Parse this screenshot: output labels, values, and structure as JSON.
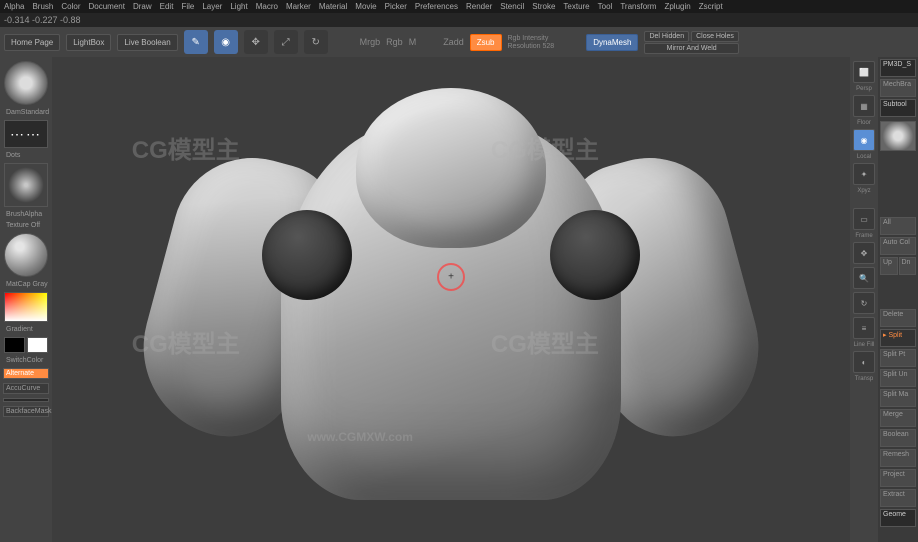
{
  "menu": [
    "Alpha",
    "Brush",
    "Color",
    "Document",
    "Draw",
    "Edit",
    "File",
    "Layer",
    "Light",
    "Macro",
    "Marker",
    "Material",
    "Movie",
    "Picker",
    "Preferences",
    "Render",
    "Stencil",
    "Stroke",
    "Texture",
    "Tool",
    "Transform",
    "Zplugin",
    "Zscript"
  ],
  "status": "-0.314 -0.227 -0.88",
  "toolbar": {
    "homepage": "Home Page",
    "lightbox": "LightBox",
    "liveboolean": "Live Boolean",
    "edit": "Edit",
    "draw": "Draw",
    "mrgb": "Mrgb",
    "rgb": "Rgb",
    "m": "M",
    "zadd": "Zadd",
    "zsub": "Zsub",
    "rgbintensity": "Rgb Intensity",
    "resolution": "Resolution 528",
    "dynamesh": "DynaMesh",
    "delhidden": "Del Hidden",
    "closeholes": "Close Holes",
    "mirrorweld": "Mirror And Weld"
  },
  "left": {
    "brush": "DamStandard",
    "stroke": "Dots",
    "alpha": "BrushAlpha",
    "texture": "Texture Off",
    "material": "MatCap Gray",
    "gradient": "Gradient",
    "switchcolor": "SwitchColor",
    "alternate": "Alternate",
    "accucurve": "AccuCurve",
    "backfacemask": "BackfaceMask"
  },
  "rightTools": {
    "persp": "Persp",
    "floor": "Floor",
    "local": "Local",
    "xpyz": "Xpyz",
    "frame": "Frame",
    "linefill": "Line Fill",
    "transp": "Transp"
  },
  "rightPanel": {
    "header": "PM3D_S",
    "mechbra": "MechBra",
    "subtool": "Subtool",
    "all": "All",
    "autocol": "Auto Col",
    "uplabel": "Up",
    "dnlabel": "Dn",
    "split": "▸ Split",
    "splitpt": "Split Pt",
    "splitun": "Split Un",
    "splitma": "Split Ma",
    "merge": "Merge",
    "boolean": "Boolean",
    "remesh": "Remesh",
    "project": "Project",
    "extract": "Extract",
    "delete": "Delete",
    "geometry": "Geome"
  },
  "watermark": "CG模型主",
  "watermarkUrl": "www.CGMXW.com"
}
